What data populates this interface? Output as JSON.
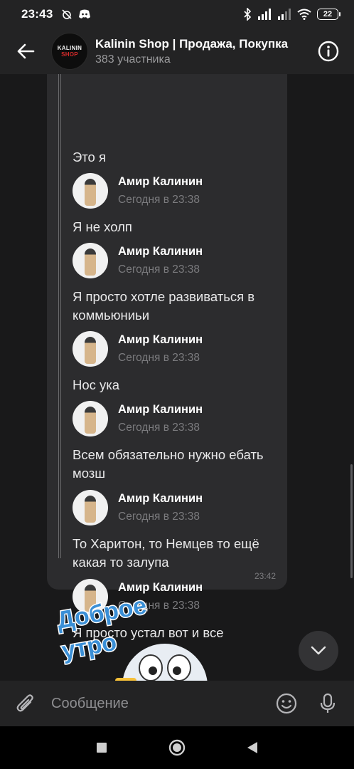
{
  "status_bar": {
    "time": "23:43",
    "battery": "22",
    "icons": [
      "alarm-off-icon",
      "discord-icon",
      "bluetooth-icon",
      "signal-icon",
      "signal-icon",
      "wifi-icon",
      "battery-icon"
    ]
  },
  "header": {
    "title": "Kalinin Shop | Продажа, Покупка",
    "subtitle": "383 участника",
    "avatar_logo_top": "KALININ",
    "avatar_logo_bottom": "SHOP"
  },
  "thread": {
    "bubble_time": "23:42",
    "messages": [
      {
        "text": "Это я"
      },
      {
        "author": "Амир Калинин",
        "time": "Сегодня в 23:38",
        "text": "Я не холп"
      },
      {
        "author": "Амир Калинин",
        "time": "Сегодня в 23:38",
        "text": "Я просто хотле развиваться в коммьюниьи"
      },
      {
        "author": "Амир Калинин",
        "time": "Сегодня в 23:38",
        "text": "Нос ука"
      },
      {
        "author": "Амир Калинин",
        "time": "Сегодня в 23:38",
        "text": "Всем обязательно нужно ебать мозш"
      },
      {
        "author": "Амир Калинин",
        "time": "Сегодня в 23:38",
        "text": "То Харитон, то Немцев то ещё какая то залупа"
      },
      {
        "author": "Амир Калинин",
        "time": "Сегодня в 23:38",
        "text": "Я просто устал вот и все"
      }
    ]
  },
  "sticker": {
    "line1": "Доброе",
    "line2": "утро"
  },
  "composer": {
    "placeholder": "Сообщение"
  },
  "colors": {
    "background": "#19191a",
    "panel": "#232324",
    "bubble": "#2c2c2e",
    "sticker_blue": "#3a8fd6"
  }
}
